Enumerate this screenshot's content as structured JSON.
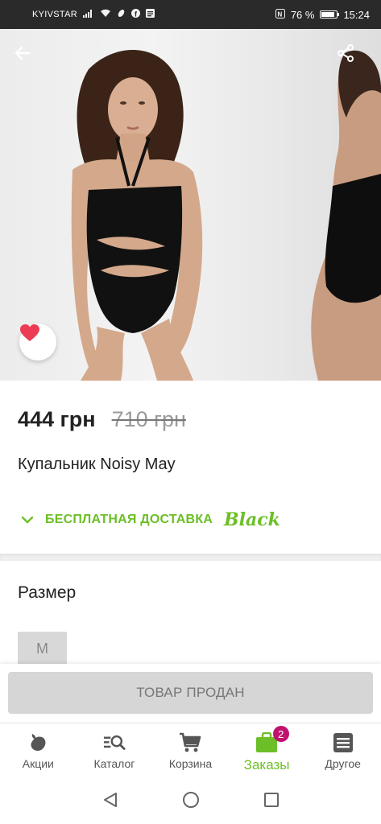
{
  "status_bar": {
    "carrier": "KYIVSTAR",
    "battery_percent": "76 %",
    "battery_level": 0.76,
    "time": "15:24"
  },
  "product": {
    "price": "444 грн",
    "old_price": "710 грн",
    "title": "Купальник Noisy May",
    "delivery": "БЕСПЛАТНАЯ ДОСТАВКА",
    "delivery_brand": "Black"
  },
  "size": {
    "heading": "Размер",
    "options": [
      "M"
    ]
  },
  "action": {
    "sold_label": "ТОВАР ПРОДАН"
  },
  "bottom_nav": {
    "items": [
      {
        "label": "Акции",
        "icon": "promo-tag-icon"
      },
      {
        "label": "Каталог",
        "icon": "catalog-search-icon"
      },
      {
        "label": "Корзина",
        "icon": "cart-icon"
      },
      {
        "label": "Заказы",
        "icon": "orders-bag-icon",
        "badge": "2",
        "active": true
      },
      {
        "label": "Другое",
        "icon": "menu-list-icon"
      }
    ]
  },
  "colors": {
    "accent_green": "#6cbf26",
    "badge": "#c0126f",
    "favorite": "#ee3b55"
  }
}
